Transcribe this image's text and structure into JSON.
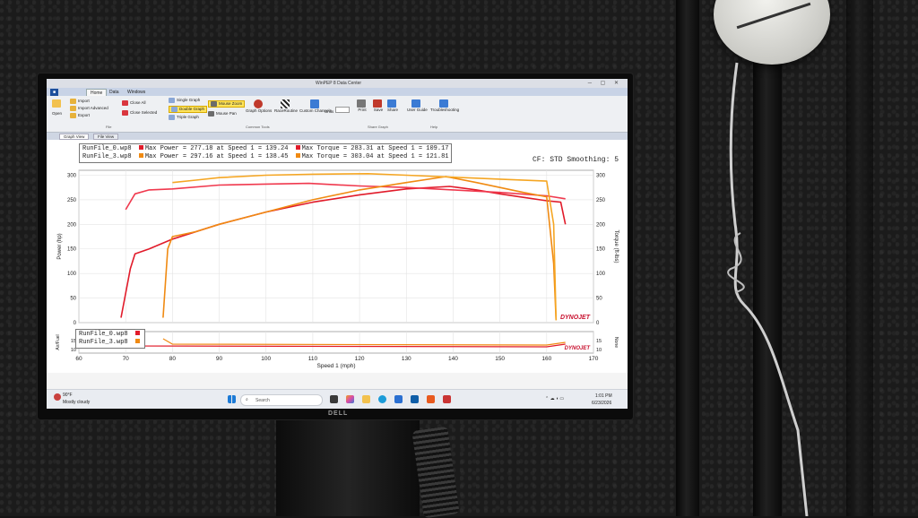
{
  "app": {
    "title": "WinPEP 8 Data Center",
    "tabs": [
      "Home",
      "Data",
      "Windows"
    ],
    "ribbon": {
      "file": {
        "items": [
          "Open",
          "Import",
          "Import Advanced",
          "Export",
          "Close All",
          "Close Selected"
        ],
        "label": "File"
      },
      "common": {
        "items": [
          "Single Graph",
          "Double Graph",
          "Triple Graph",
          "Mouse Zoom",
          "Mouse Pan",
          "Graph Options",
          "RaceRoutine",
          "Custom Channels",
          "Units"
        ],
        "label": "Common Tools"
      },
      "share": {
        "items": [
          "Print",
          "Save",
          "Share"
        ],
        "label": "Share Graph"
      },
      "help": {
        "items": [
          "User Guide",
          "Troubleshooting"
        ],
        "label": "Help"
      }
    },
    "subtabs": [
      "Graph View",
      "File View"
    ]
  },
  "graph": {
    "legend_top": [
      {
        "file": "RunFile_0.wp8",
        "color": "#e11b2a",
        "power": "Max Power = 277.18 at Speed 1 = 139.24",
        "torque": "Max Torque = 283.31 at Speed 1 = 109.17"
      },
      {
        "file": "RunFile_3.wp8",
        "color": "#f08a12",
        "power": "Max Power = 297.16 at Speed 1 = 138.45",
        "torque": "Max Torque = 303.04 at Speed 1 = 121.81"
      }
    ],
    "cf_text": "CF: STD Smoothing: 5",
    "legend_bottom": [
      "RunFile_0.wp8",
      "RunFile_3.wp8"
    ],
    "logo": "DYNOJET",
    "colors": {
      "run0_power": "#e11b2a",
      "run0_torque": "#f0394e",
      "run3_power": "#f08a12",
      "run3_torque": "#f5a623"
    }
  },
  "chart_data": {
    "type": "line",
    "xlabel": "Speed 1 (mph)",
    "ylabel_left": "Power (hp)",
    "ylabel_right": "Torque (ft-lbs)",
    "ylabel_lower_left": "Air/Fuel",
    "ylabel_lower_right": "None",
    "xlim": [
      60,
      170
    ],
    "x_ticks": [
      60,
      70,
      80,
      90,
      100,
      110,
      120,
      130,
      140,
      150,
      160,
      170
    ],
    "ylim_left": [
      0,
      310
    ],
    "y_ticks_left": [
      0,
      50,
      100,
      150,
      200,
      250,
      300
    ],
    "ylim_right": [
      0,
      310
    ],
    "y_ticks_right": [
      0,
      50,
      100,
      150,
      200,
      250,
      300
    ],
    "lower_ticks": [
      10,
      15
    ],
    "series": [
      {
        "name": "RunFile_0.wp8",
        "metric": "power",
        "color": "#e11b2a",
        "x": [
          69,
          70,
          71,
          72,
          75,
          80,
          90,
          100,
          110,
          120,
          130,
          139.24,
          145,
          150,
          155,
          160,
          163,
          164
        ],
        "y": [
          10,
          60,
          110,
          140,
          150,
          170,
          200,
          225,
          245,
          260,
          272,
          277.18,
          270,
          262,
          255,
          248,
          245,
          200
        ]
      },
      {
        "name": "RunFile_0.wp8",
        "metric": "torque",
        "color": "#f0394e",
        "x": [
          70,
          72,
          75,
          80,
          90,
          100,
          109.17,
          120,
          130,
          140,
          150,
          160,
          164
        ],
        "y": [
          230,
          262,
          270,
          272,
          280,
          282,
          283.31,
          278,
          275,
          270,
          265,
          258,
          252
        ]
      },
      {
        "name": "RunFile_3.wp8",
        "metric": "power",
        "color": "#f08a12",
        "x": [
          78,
          78.5,
          79,
          80,
          85,
          90,
          100,
          110,
          120,
          130,
          138.45,
          145,
          150,
          155,
          160,
          161.5,
          162
        ],
        "y": [
          10,
          80,
          150,
          175,
          185,
          200,
          225,
          250,
          270,
          285,
          297.16,
          285,
          275,
          265,
          256,
          120,
          5
        ]
      },
      {
        "name": "RunFile_3.wp8",
        "metric": "torque",
        "color": "#f5a623",
        "x": [
          80,
          85,
          90,
          100,
          110,
          121.81,
          130,
          140,
          150,
          160,
          161.5,
          162
        ],
        "y": [
          285,
          290,
          295,
          300,
          302,
          303.04,
          300,
          296,
          292,
          288,
          200,
          5
        ]
      }
    ]
  },
  "taskbar": {
    "weather_temp": "90°F",
    "weather_desc": "Mostly cloudy",
    "search_placeholder": "Search",
    "time": "1:01 PM",
    "date": "6/23/2026"
  },
  "monitor_brand": "DELL"
}
